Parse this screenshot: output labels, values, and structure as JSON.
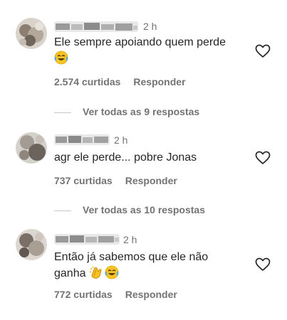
{
  "comments": [
    {
      "time": "2 h",
      "text": "Ele sempre apoiando quem perde",
      "emojis": [
        "face-with-tears-of-joy"
      ],
      "likes": "2.574 curtidas",
      "reply_label": "Responder",
      "view_replies": "Ver todas as 9 respostas"
    },
    {
      "time": "2 h",
      "text": "agr ele perde... pobre Jonas",
      "emojis": [],
      "likes": "737 curtidas",
      "reply_label": "Responder",
      "view_replies": "Ver todas as 10 respostas"
    },
    {
      "time": "2 h",
      "text_line1": "Então já sabemos que ele não",
      "text_line2": "ganha",
      "emojis": [
        "clapping-hands",
        "face-with-tears-of-joy"
      ],
      "likes": "772 curtidas",
      "reply_label": "Responder"
    }
  ],
  "colors": {
    "text": "#262626",
    "secondary": "#737373",
    "divider": "#c7c7c7",
    "emoji_yellow": "#f7c325"
  }
}
